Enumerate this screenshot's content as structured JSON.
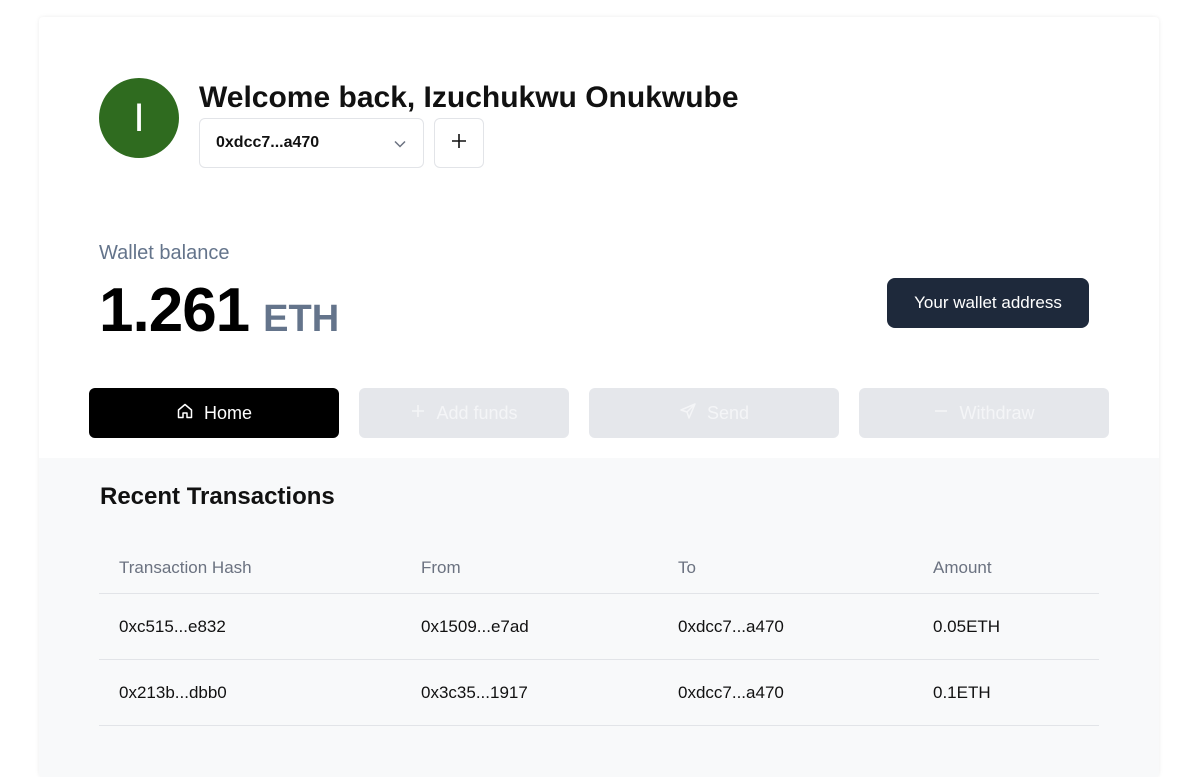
{
  "user": {
    "avatar_initial": "I",
    "avatar_color": "#2f6b1f",
    "welcome_text": "Welcome back, Izuchukwu Onukwube",
    "selected_address": "0xdcc7...a470"
  },
  "balance": {
    "label": "Wallet balance",
    "amount": "1.261",
    "unit": "ETH"
  },
  "actions": {
    "wallet_address_label": "Your wallet address",
    "nav": [
      {
        "label": "Home",
        "icon": "home-icon",
        "active": true
      },
      {
        "label": "Add funds",
        "icon": "plus-icon",
        "active": false
      },
      {
        "label": "Send",
        "icon": "send-icon",
        "active": false
      },
      {
        "label": "Withdraw",
        "icon": "minus-icon",
        "active": false
      }
    ]
  },
  "transactions": {
    "title": "Recent Transactions",
    "columns": [
      "Transaction Hash",
      "From",
      "To",
      "Amount"
    ],
    "rows": [
      {
        "hash": "0xc515...e832",
        "from": "0x1509...e7ad",
        "to": "0xdcc7...a470",
        "amount": "0.05ETH"
      },
      {
        "hash": "0x213b...dbb0",
        "from": "0x3c35...1917",
        "to": "0xdcc7...a470",
        "amount": "0.1ETH"
      }
    ]
  },
  "colors": {
    "primary_dark": "#1e293b",
    "muted_text": "#64748b",
    "disabled_bg": "#e5e7eb"
  }
}
